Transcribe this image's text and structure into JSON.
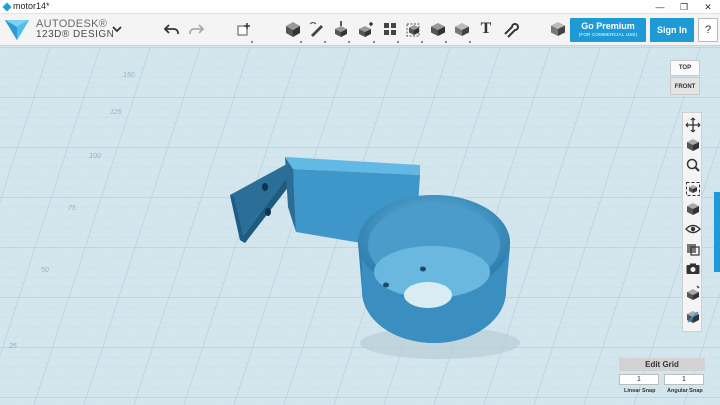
{
  "window": {
    "document_title": "motor14*",
    "minimize_glyph": "—",
    "restore_glyph": "❐",
    "close_glyph": "✕"
  },
  "brand": {
    "company": "AUTODESK®",
    "product": "123D® DESIGN",
    "menu_icon": "chevron-down-icon",
    "logo_icon": "app-logo-icon"
  },
  "toolbar": {
    "tools": [
      {
        "name": "undo-icon"
      },
      {
        "name": "redo-icon"
      },
      {
        "name": "transform-icon"
      },
      {
        "name": "primitives-icon"
      },
      {
        "name": "sketch-icon"
      },
      {
        "name": "construct-icon"
      },
      {
        "name": "modify-icon"
      },
      {
        "name": "pattern-icon"
      },
      {
        "name": "grouping-icon"
      },
      {
        "name": "combine-icon"
      },
      {
        "name": "measure-icon"
      },
      {
        "name": "text-icon",
        "label": "T"
      },
      {
        "name": "snap-icon"
      },
      {
        "name": "material-icon"
      }
    ],
    "premium_title": "Go Premium",
    "premium_subtitle": "(FOR COMMERCIAL USE)",
    "sign_in": "Sign In",
    "help": "?"
  },
  "colors": {
    "accent": "#1e9ad6",
    "model": "#3a8fc0",
    "grid_bg": "#d3e6ee",
    "grid_line": "#b3cfdc"
  },
  "grid_labels": [
    "150",
    "125",
    "100",
    "75",
    "50",
    "25"
  ],
  "viewcube": {
    "top": "TOP",
    "front": "FRONT"
  },
  "navigation": [
    {
      "name": "pan-icon"
    },
    {
      "name": "orbit-icon"
    },
    {
      "name": "zoom-icon"
    },
    {
      "name": "fit-icon"
    },
    {
      "name": "views-icon"
    },
    {
      "name": "visibility-icon"
    },
    {
      "name": "materials-outlines-icon"
    },
    {
      "name": "screenshot-icon"
    },
    {
      "name": "grid-settings-icon"
    },
    {
      "name": "render-style-icon"
    }
  ],
  "grid_panel": {
    "title": "Edit Grid",
    "linear_value": "1",
    "angular_value": "1",
    "linear_label": "Linear Snap",
    "angular_label": "Angular Snap"
  }
}
